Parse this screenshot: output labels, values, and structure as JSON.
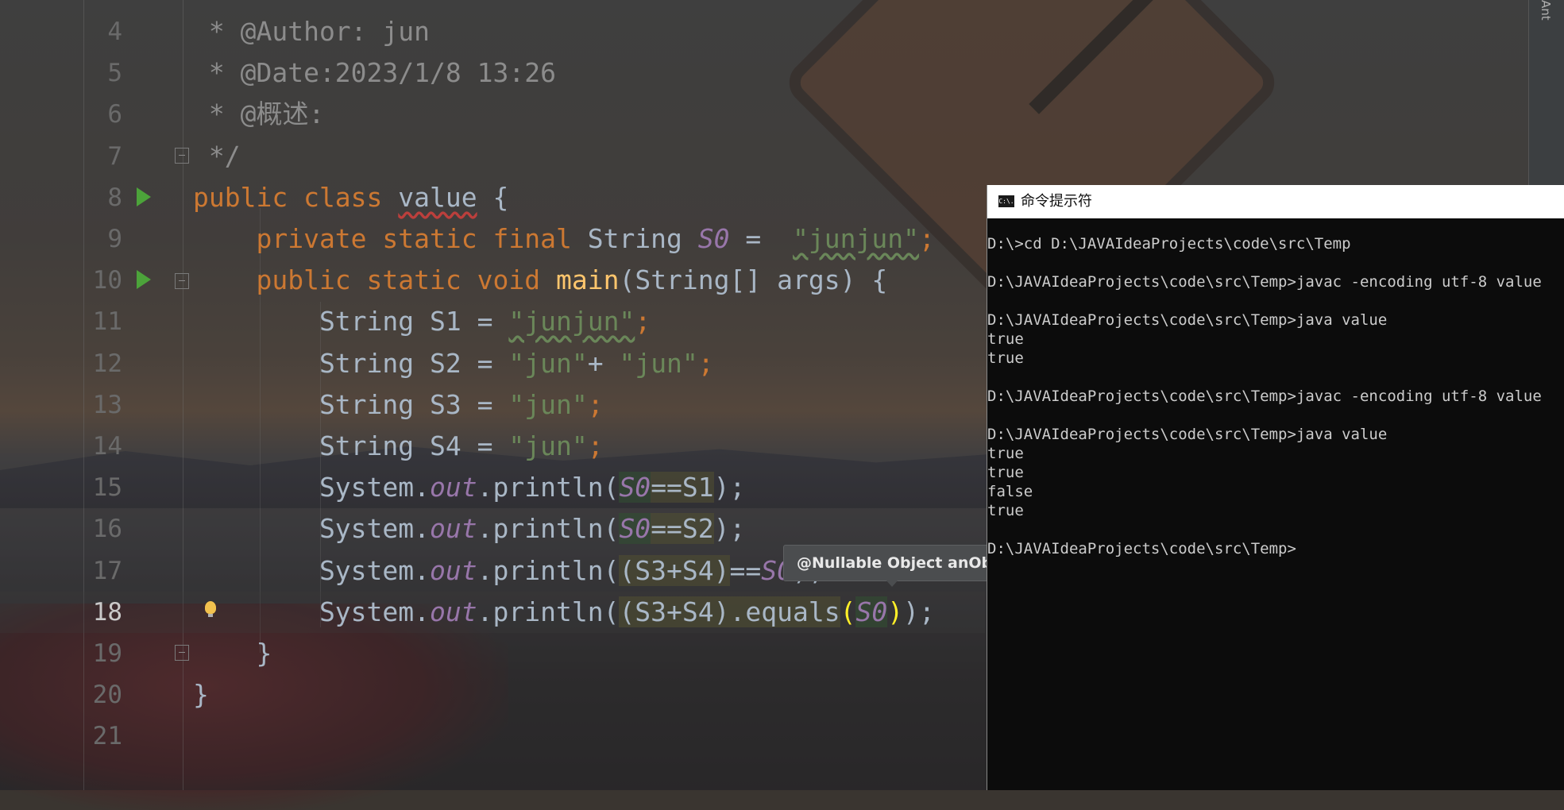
{
  "editor": {
    "lines": [
      {
        "num": "4",
        "parts": [
          {
            "t": " * @Author: jun",
            "c": "cm"
          }
        ]
      },
      {
        "num": "5",
        "parts": [
          {
            "t": " * @Date:2023/1/8 13:26",
            "c": "cm"
          }
        ]
      },
      {
        "num": "6",
        "parts": [
          {
            "t": " * @概述:",
            "c": "cm"
          }
        ]
      },
      {
        "num": "7",
        "parts": [
          {
            "t": " */",
            "c": "cm"
          }
        ]
      },
      {
        "num": "8",
        "parts": [
          {
            "t": "public class ",
            "c": "kw"
          },
          {
            "t": "value",
            "c": "pl sqr"
          },
          {
            "t": " {",
            "c": "pl"
          }
        ]
      },
      {
        "num": "9",
        "parts": [
          {
            "t": "    private static final ",
            "c": "kw"
          },
          {
            "t": "String ",
            "c": "pl"
          },
          {
            "t": "S0",
            "c": "fld"
          },
          {
            "t": " =  ",
            "c": "pl"
          },
          {
            "t": "\"junjun\"",
            "c": "str sq"
          },
          {
            "t": ";",
            "c": "kw"
          }
        ]
      },
      {
        "num": "10",
        "parts": [
          {
            "t": "    public static void ",
            "c": "kw"
          },
          {
            "t": "main",
            "c": "fn"
          },
          {
            "t": "(String[] args) {",
            "c": "pl"
          }
        ]
      },
      {
        "num": "11",
        "parts": [
          {
            "t": "        String S1 = ",
            "c": "pl"
          },
          {
            "t": "\"junjun\"",
            "c": "str sq"
          },
          {
            "t": ";",
            "c": "kw"
          }
        ]
      },
      {
        "num": "12",
        "parts": [
          {
            "t": "        String S2 = ",
            "c": "pl"
          },
          {
            "t": "\"jun\"",
            "c": "str"
          },
          {
            "t": "+ ",
            "c": "pl"
          },
          {
            "t": "\"jun\"",
            "c": "str"
          },
          {
            "t": ";",
            "c": "kw"
          }
        ]
      },
      {
        "num": "13",
        "parts": [
          {
            "t": "        String S3 = ",
            "c": "pl"
          },
          {
            "t": "\"jun\"",
            "c": "str"
          },
          {
            "t": ";",
            "c": "kw"
          }
        ]
      },
      {
        "num": "14",
        "parts": [
          {
            "t": "        String S4 = ",
            "c": "pl"
          },
          {
            "t": "\"jun\"",
            "c": "str"
          },
          {
            "t": ";",
            "c": "kw"
          }
        ]
      },
      {
        "num": "15",
        "parts": [
          {
            "t": "        System.",
            "c": "pl"
          },
          {
            "t": "out",
            "c": "fld"
          },
          {
            "t": ".println(",
            "c": "pl"
          },
          {
            "t": "S0",
            "c": "fld hlg"
          },
          {
            "t": "==S1",
            "c": "pl hl"
          },
          {
            "t": ");",
            "c": "pl"
          }
        ]
      },
      {
        "num": "16",
        "parts": [
          {
            "t": "        System.",
            "c": "pl"
          },
          {
            "t": "out",
            "c": "fld"
          },
          {
            "t": ".println(",
            "c": "pl"
          },
          {
            "t": "S0",
            "c": "fld hlg"
          },
          {
            "t": "==S2",
            "c": "pl hl"
          },
          {
            "t": ");",
            "c": "pl"
          }
        ]
      },
      {
        "num": "17",
        "parts": [
          {
            "t": "        System.",
            "c": "pl"
          },
          {
            "t": "out",
            "c": "fld"
          },
          {
            "t": ".println(",
            "c": "pl"
          },
          {
            "t": "(S3+S4)",
            "c": "pl hl"
          },
          {
            "t": "==",
            "c": "pl"
          },
          {
            "t": "S0",
            "c": "fld"
          },
          {
            "t": ");",
            "c": "pl"
          }
        ]
      },
      {
        "num": "18",
        "current": true,
        "parts": [
          {
            "t": "        System.",
            "c": "pl"
          },
          {
            "t": "out",
            "c": "fld"
          },
          {
            "t": ".println(",
            "c": "pl"
          },
          {
            "t": "(S3+S4).equals",
            "c": "pl hl"
          },
          {
            "t": "(",
            "c": "paren"
          },
          {
            "t": "S0",
            "c": "fld hlg"
          },
          {
            "t": ")",
            "c": "paren"
          },
          {
            "t": ");",
            "c": "pl"
          }
        ]
      },
      {
        "num": "19",
        "parts": [
          {
            "t": "    }",
            "c": "pl"
          }
        ]
      },
      {
        "num": "20",
        "parts": [
          {
            "t": "}",
            "c": "pl"
          }
        ]
      },
      {
        "num": "21",
        "parts": [
          {
            "t": "",
            "c": "pl"
          }
        ]
      }
    ]
  },
  "tooltip": {
    "text": "@Nullable Object anObject"
  },
  "side_panel": {
    "label": "Ant"
  },
  "cmd": {
    "title": "命令提示符",
    "icon_text": "C:\\.",
    "lines": [
      "D:\\>cd D:\\JAVAIdeaProjects\\code\\src\\Temp",
      "",
      "D:\\JAVAIdeaProjects\\code\\src\\Temp>javac -encoding utf-8 value",
      "",
      "D:\\JAVAIdeaProjects\\code\\src\\Temp>java value",
      "true",
      "true",
      "",
      "D:\\JAVAIdeaProjects\\code\\src\\Temp>javac -encoding utf-8 value",
      "",
      "D:\\JAVAIdeaProjects\\code\\src\\Temp>java value",
      "true",
      "true",
      "false",
      "true",
      "",
      "D:\\JAVAIdeaProjects\\code\\src\\Temp>"
    ]
  }
}
